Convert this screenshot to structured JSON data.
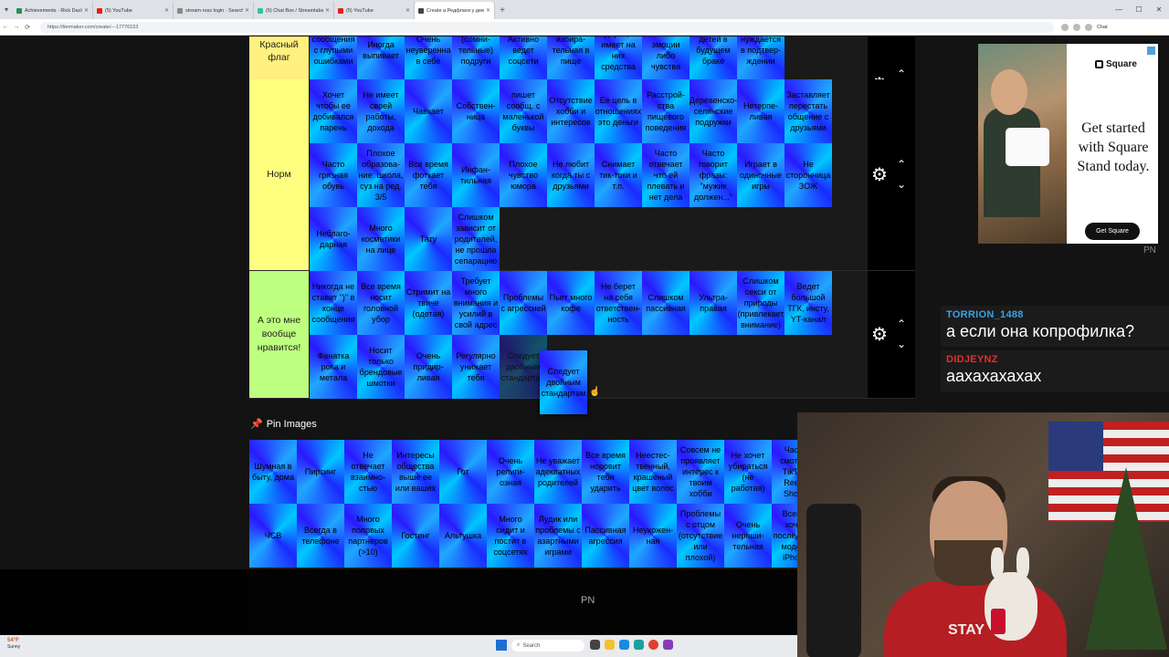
{
  "browser": {
    "tabs": [
      {
        "title": "Achievements · Rick Dachkouvi",
        "color": "#2e8b57"
      },
      {
        "title": "(5) YouTube",
        "color": "#e62117"
      },
      {
        "title": "stream·ross login · Search",
        "color": "#888888"
      },
      {
        "title": "(5) Chat Box / Streamlabs",
        "color": "#31c3a2"
      },
      {
        "title": "(5) YouTube",
        "color": "#e62117"
      },
      {
        "title": "Create a Редфлаги у девушек Ti...",
        "color": "#444444",
        "active": true
      }
    ],
    "url": "https://tiermaker.com/create/---17776153"
  },
  "tiers": [
    {
      "label": "Красный флаг",
      "color": "#fff07f",
      "rows": 1,
      "items": [
        "сообщения с глупыми ошибками",
        "Иногда выпивает",
        "Очень неуверенна в себе",
        "(сомни-тельные) подруги",
        "Активно ведет соцсети",
        "избира-тельная в пище",
        "подарки, но имеет на них средства",
        "вает свои эмоции либо чувства",
        "детей в будущем браке",
        "нуждается в подтвер-ждении"
      ]
    },
    {
      "label": "Норм",
      "color": "#ffff7f",
      "rows": 3,
      "items": [
        "Хочет чтобы ее добивался парень",
        "Не имеет своей работы, дохода",
        "Чавкает",
        "Собствен-ница",
        "пишет сообщ. с маленькой буквы",
        "Отсутствие хобби и интересов",
        "Ее цель в отношениях это деньги",
        "Расстрой-ства пищевого поведения",
        "Деревенско-селянские подружки",
        "Нетерпе-ливая",
        "Заставляет перестать общение с друзьями",
        "Часто грязная обувь",
        "Плохое образова-ние: школа, суз на ред. 3/5",
        "Все время фоткает тебя",
        "Инфан-тильная",
        "Плохое чувство юмора",
        "Не любит когда ты с друзьями",
        "Снимает тик-токи и т.п.",
        "Часто отвечает что ей плевать и нет дела",
        "Часто говорит фразы: \"мужик должен...\"",
        "Играет в одиночные игры",
        "Не сторонница ЗОЖ",
        "Неблаго-дарная",
        "Много косметики на лице",
        "Тату",
        "Слишком зависит от родителей, не прошла сепарацию"
      ]
    },
    {
      "label": "А это мне вообще нравится!",
      "color": "#bfff7f",
      "rows": 2,
      "items": [
        "Никогда не ставит \")\" в конце сообщения",
        "Все время носит головной убор",
        "Стримит на твиче (одетая)",
        "Требует много внимания и усилий в свой адрес",
        "Проблемы с агрессией",
        "Пьет много кофе",
        "Не берет на себя ответствен-ность",
        "Слишком пассивная",
        "Ультра-правая",
        "Слишком секси от природы (привлекает внимание)",
        "Ведет большой ТГК, инсту, YT-канал",
        "Фанатка рока и метала",
        "Носит только брендовые шмотки",
        "Очень придир-ливая",
        "Регулярно унижает тебя",
        "Следует двойным стандартам"
      ]
    }
  ],
  "dragging_item": "Следует двойным стандартам",
  "pin_images": {
    "title": "Pin Images",
    "row1": [
      "Шумная в быту, дома",
      "Пирсинг",
      "Не отвечает взаимно-стью",
      "Интересы общества выше ее или ваших",
      "Гот",
      "Очень религи-озная",
      "Не уважает адекватных родителей",
      "Все время норовит тебя ударить",
      "Неестес-твенный, крашеный цвет волос",
      "Совсем не проявляет интерес к твоим хобби",
      "Не хочет убираться (не работая)",
      "Часто смотрит ТikTok, Reels, Shorts"
    ],
    "row2": [
      "ЧСВ",
      "Всегда в телефоне",
      "Много половых партнеров (>10)",
      "Гостинг",
      "Альтушка",
      "Много сидит и постит в соцсетях",
      "Лудик или проблемы с азартными играми",
      "Пассивная агрессия",
      "Неухожен-ная",
      "Проблемы с отцом (отсутствие или плохой)",
      "Очень нереши-тельная",
      "Всегда хочет последнюю модель iPhone"
    ]
  },
  "overlay": {
    "pn_label": "PN"
  },
  "ad": {
    "brand": "Square",
    "headline": "Get started with Square Stand today.",
    "cta": "Get Square",
    "pn_label": "PN"
  },
  "chat": [
    {
      "user": "TORRION_1488",
      "color": "#3da0e6",
      "text": "а если она копрофилка?"
    },
    {
      "user": "DIDJEYNZ",
      "color": "#e03030",
      "text": "аахахахахах"
    }
  ],
  "webcam": {
    "shirt_text": "STAY"
  },
  "taskbar": {
    "weather_temp": "54°F",
    "weather_desc": "Sunny",
    "search_placeholder": "Search"
  }
}
